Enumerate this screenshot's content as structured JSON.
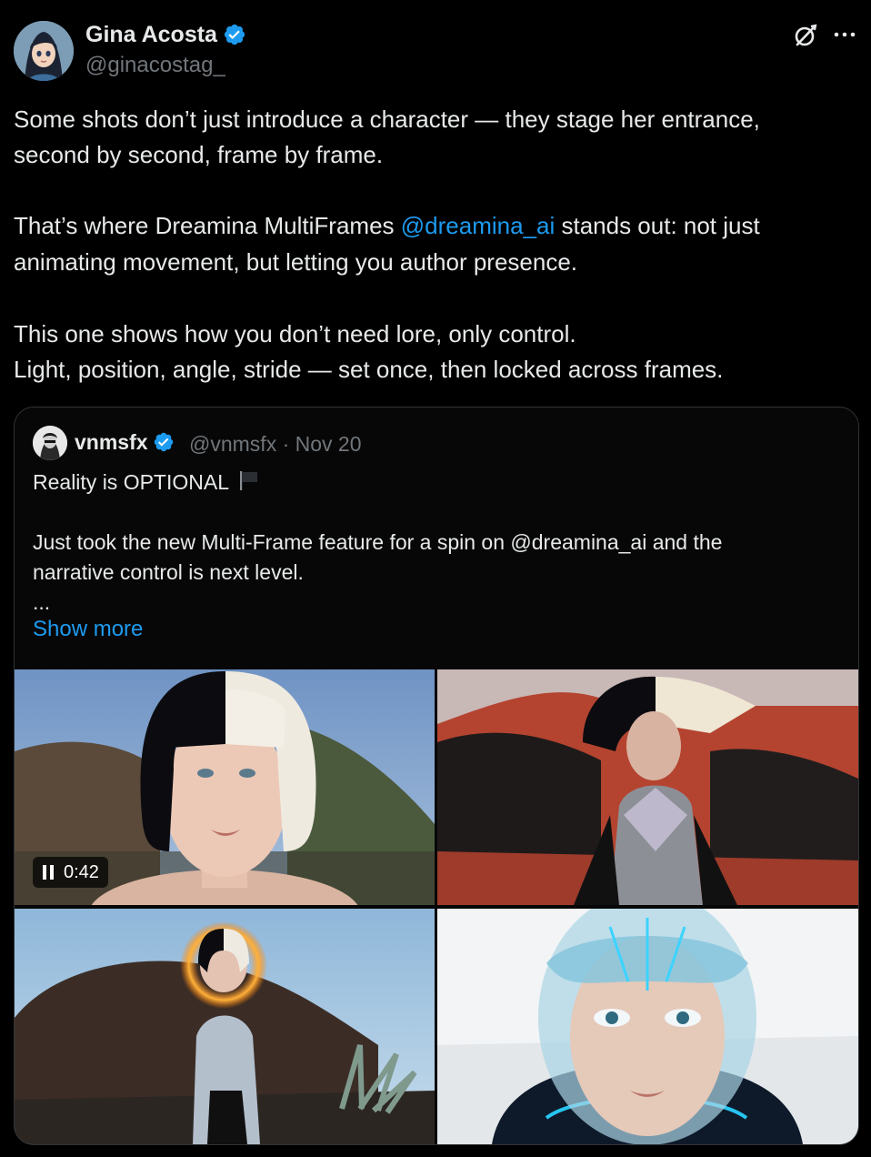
{
  "author": {
    "name": "Gina Acosta",
    "handle": "@ginacostag_",
    "verified_color": "#1d9bf0"
  },
  "header_actions": {
    "grok_icon": "grok-icon",
    "more_icon": "more-icon"
  },
  "tweet": {
    "line1": "Some shots don’t just introduce a character — they stage her entrance,",
    "line2": "second by second, frame by frame.",
    "line3_pre": "That’s where Dreamina MultiFrames ",
    "line3_mention": "@dreamina_ai",
    "line3_post": " stands out: not just",
    "line4": "animating movement, but letting you author presence.",
    "line5": "This one shows how you don’t need lore, only control.",
    "line6": "Light, position, angle, stride — set once, then locked across frames."
  },
  "quote": {
    "name": "vnmsfx",
    "meta": "@vnmsfx · Nov 20",
    "line1": "Reality is OPTIONAL",
    "line2": "Just took the new Multi-Frame feature for a spin on @dreamina_ai  and the",
    "line3": "narrative control is next level.",
    "line4": "...",
    "show_more": "Show more",
    "video_duration": "0:42"
  },
  "colors": {
    "background": "#000000",
    "text": "#e7e9ea",
    "muted": "#71767b",
    "accent": "#1d9bf0",
    "border": "#2f3336"
  }
}
